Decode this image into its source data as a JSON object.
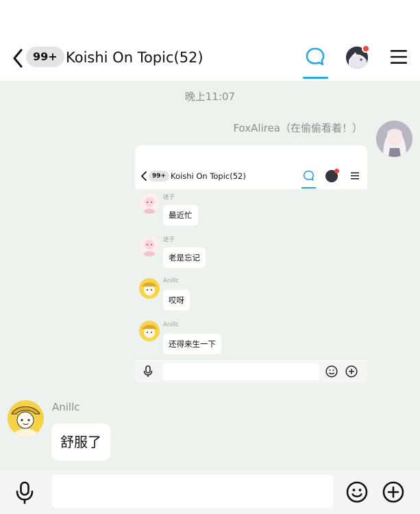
{
  "header": {
    "unread_badge": "99+",
    "title": "Koishi On Topic(52)"
  },
  "messages": {
    "timestamp": "晚上11:07",
    "outgoing": {
      "sender": "FoxAlirea（在偷偷看着！）",
      "screenshot": {
        "badge": "99+",
        "title": "Koishi On Topic(52)",
        "items": [
          {
            "name": "迷子",
            "text": "最近忙"
          },
          {
            "name": "迷子",
            "text": "老是忘记"
          },
          {
            "name": "Anillc",
            "text": "哎呀"
          },
          {
            "name": "Anillc",
            "text": "还得来生一下"
          }
        ]
      }
    },
    "incoming": {
      "sender": "Anillc",
      "text": "舒服了"
    }
  },
  "colors": {
    "accent": "#2aa6e6",
    "notification": "#f0453a",
    "chat_background": "#edf2ee"
  },
  "icons": [
    "back-chevron-icon",
    "chat-bubble-icon",
    "menu-icon",
    "microphone-icon",
    "emoji-icon",
    "plus-icon"
  ]
}
